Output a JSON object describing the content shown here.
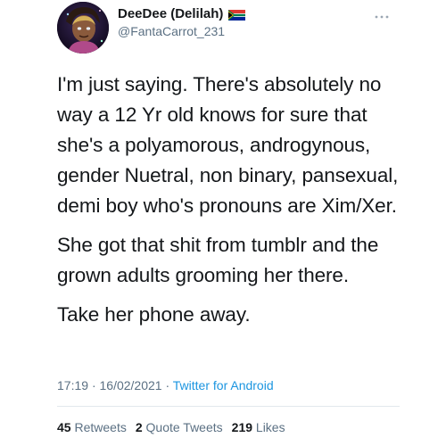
{
  "author": {
    "display_name": "DeeDee (Delilah)",
    "handle": "@FantaCarrot_231",
    "flag_icon": "south-africa-flag-icon",
    "avatar_icon": "avatar-icon"
  },
  "tweet": {
    "paragraphs": [
      "I'm just saying. There's absolutely no way a 12 Yr old knows for sure that she's a polyamorous, androgynous, gender Nuetral, non binary, pansexual, demi boy who's pronouns are Xim/Xer.",
      "She got that shit from tumblr and the grown adults grooming her there.",
      "Take her phone away."
    ],
    "time": "17:19",
    "date": "16/02/2021",
    "separator": "·",
    "source": "Twitter for Android"
  },
  "stats": {
    "retweets_count": "45",
    "retweets_label": "Retweets",
    "quote_count": "2",
    "quote_label": "Quote Tweets",
    "likes_count": "219",
    "likes_label": "Likes"
  },
  "colors": {
    "text": "#14171a",
    "secondary": "#5b7083",
    "link": "#1b95e0",
    "divider": "#e1e8ed"
  }
}
